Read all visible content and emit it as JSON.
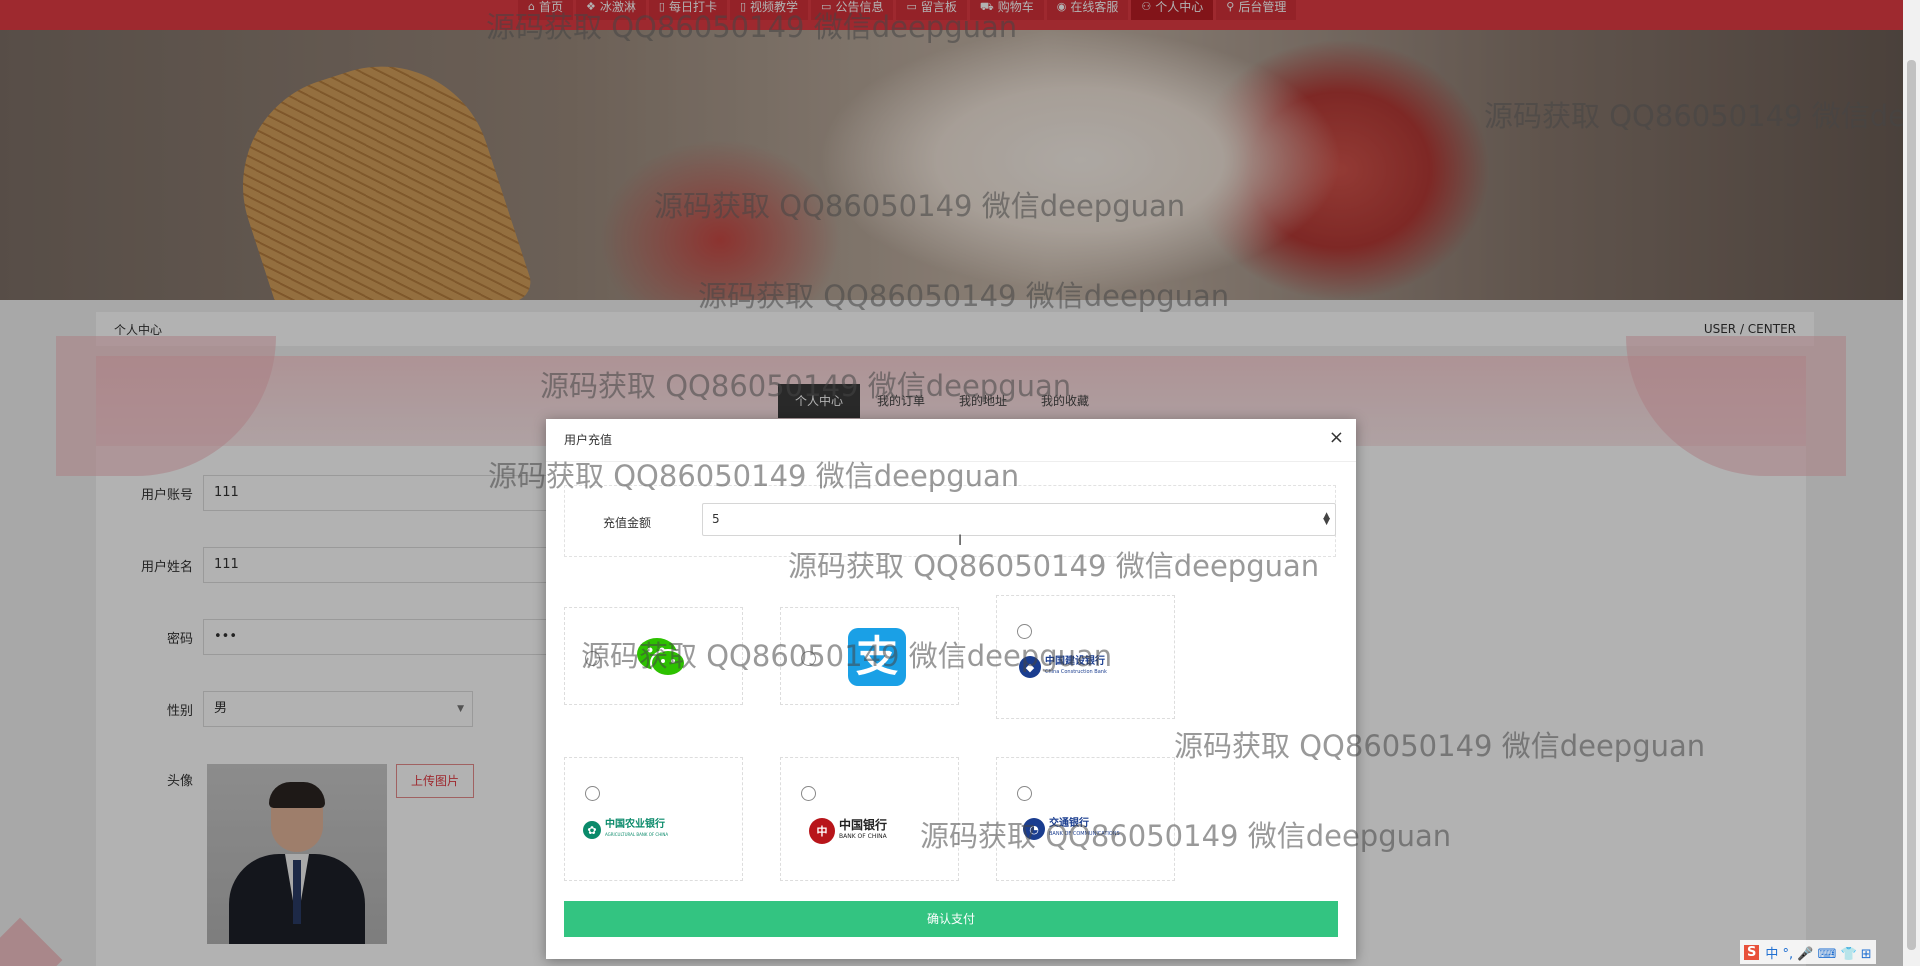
{
  "nav": {
    "items": [
      {
        "icon": "home-icon",
        "label": "首页",
        "active": false
      },
      {
        "icon": "gift-icon",
        "label": "冰激淋",
        "active": false
      },
      {
        "icon": "doc-icon",
        "label": "每日打卡",
        "active": false
      },
      {
        "icon": "video-icon",
        "label": "视频教学",
        "active": false
      },
      {
        "icon": "note-icon",
        "label": "公告信息",
        "active": false
      },
      {
        "icon": "note-icon",
        "label": "留言板",
        "active": false
      },
      {
        "icon": "cart-icon",
        "label": "购物车",
        "active": false
      },
      {
        "icon": "chat-icon",
        "label": "在线客服",
        "active": false
      },
      {
        "icon": "user-icon",
        "label": "个人中心",
        "active": true
      },
      {
        "icon": "link-icon",
        "label": "后台管理",
        "active": false
      }
    ]
  },
  "breadcrumb": {
    "left": "个人中心",
    "right": "USER / CENTER"
  },
  "tabs": [
    {
      "label": "个人中心",
      "active": true
    },
    {
      "label": "我的订单",
      "active": false
    },
    {
      "label": "我的地址",
      "active": false
    },
    {
      "label": "我的收藏",
      "active": false
    }
  ],
  "form": {
    "account_label": "用户账号",
    "account_value": "111",
    "name_label": "用户姓名",
    "name_value": "111",
    "password_label": "密码",
    "password_value": "•••",
    "gender_label": "性别",
    "gender_value": "男",
    "avatar_label": "头像",
    "upload_label": "上传图片"
  },
  "modal": {
    "title": "用户充值",
    "close": "×",
    "amount_label": "充值金额",
    "amount_value": "5",
    "confirm_label": "确认支付",
    "payments": [
      {
        "name": "wechat-pay",
        "icon": "wechat-icon"
      },
      {
        "name": "alipay",
        "icon": "alipay-icon",
        "glyph": "支"
      },
      {
        "name": "ccb",
        "icon": "ccb-icon",
        "text": "中国建设银行",
        "sub": "China Construction Bank"
      },
      {
        "name": "abc",
        "icon": "abc-icon",
        "text": "中国农业银行",
        "sub": "AGRICULTURAL BANK OF CHINA"
      },
      {
        "name": "boc",
        "icon": "boc-icon",
        "text": "中国银行",
        "sub": "BANK OF CHINA"
      },
      {
        "name": "bocom",
        "icon": "bocom-icon",
        "text": "交通银行",
        "sub": "BANK OF COMMUNICATIONS"
      }
    ]
  },
  "watermark": "源码获取 QQ86050149 微信deepguan",
  "ime": {
    "s": "S",
    "text": "中 °, 🎤 ⌨ 👕 ⊞"
  },
  "colors": {
    "nav_red": "#e23c44",
    "confirm_green": "#33c481",
    "ccb_blue": "#1a3d8f",
    "abc_green": "#0a8a6a",
    "boc_red": "#b8151a"
  }
}
